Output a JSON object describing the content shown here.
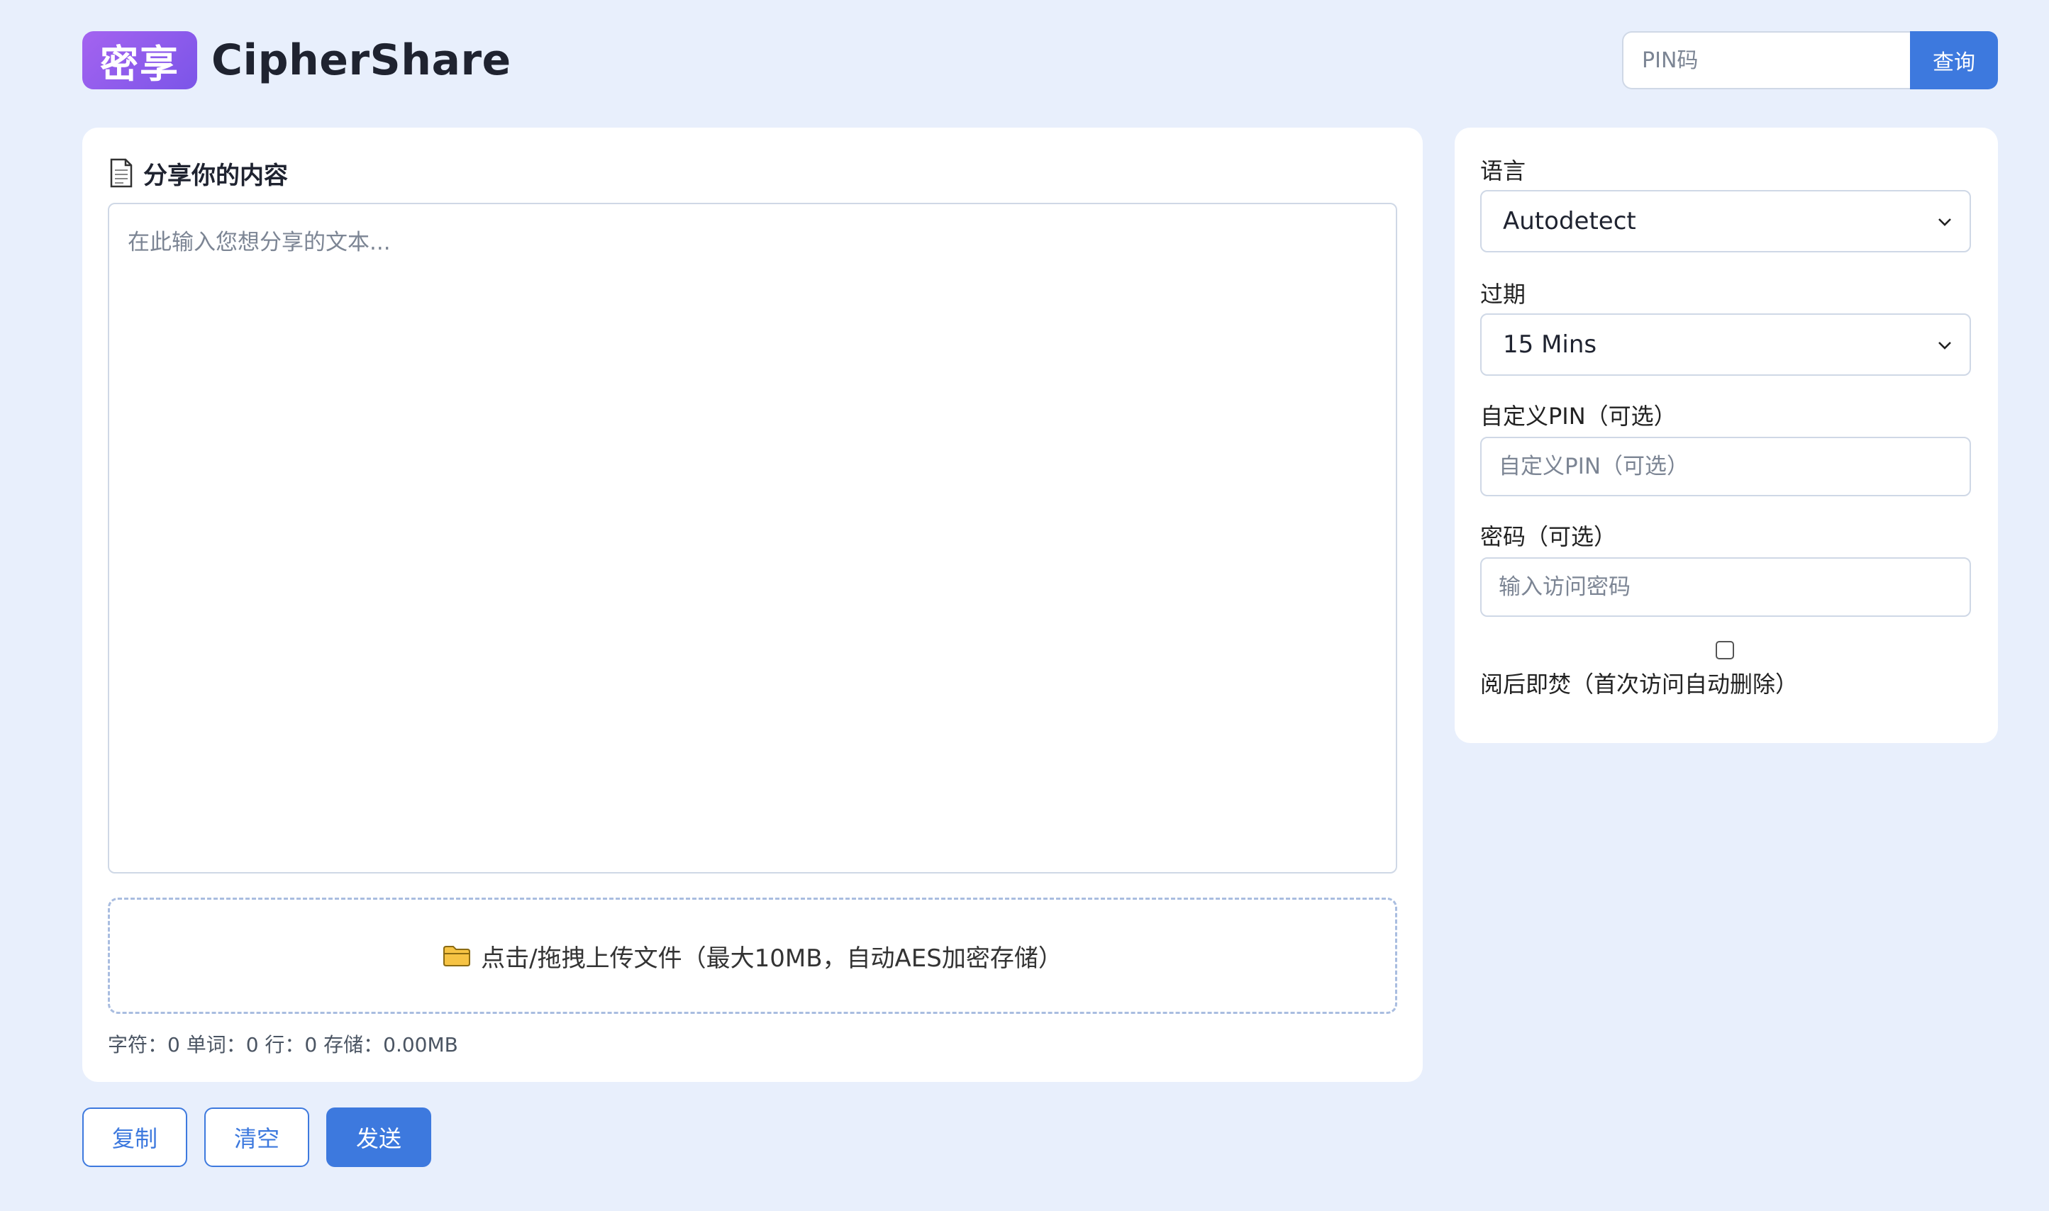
{
  "header": {
    "logo_text": "密享",
    "brand_name": "CipherShare",
    "pin_placeholder": "PIN码",
    "query_label": "查询"
  },
  "main": {
    "title": "分享你的内容",
    "textarea_placeholder": "在此输入您想分享的文本...",
    "upload_text": "点击/拖拽上传文件（最大10MB，自动AES加密存储）",
    "stats": "字符：0 单词：0 行：0 存储：0.00MB"
  },
  "actions": {
    "copy_label": "复制",
    "clear_label": "清空",
    "send_label": "发送"
  },
  "sidebar": {
    "language_label": "语言",
    "language_value": "Autodetect",
    "expiry_label": "过期",
    "expiry_value": "15 Mins",
    "custom_pin_label": "自定义PIN（可选）",
    "custom_pin_placeholder": "自定义PIN（可选）",
    "password_label": "密码（可选）",
    "password_placeholder": "输入访问密码",
    "burn_label": "阅后即焚（首次访问自动删除）",
    "burn_checked": false
  },
  "colors": {
    "background": "#e8effc",
    "primary": "#3d79de",
    "logo_gradient_start": "#a463f0",
    "logo_gradient_end": "#7b55e8"
  },
  "icons": {
    "title_icon": "document-icon",
    "upload_icon": "folder-icon",
    "select_icon": "chevron-down-icon"
  }
}
